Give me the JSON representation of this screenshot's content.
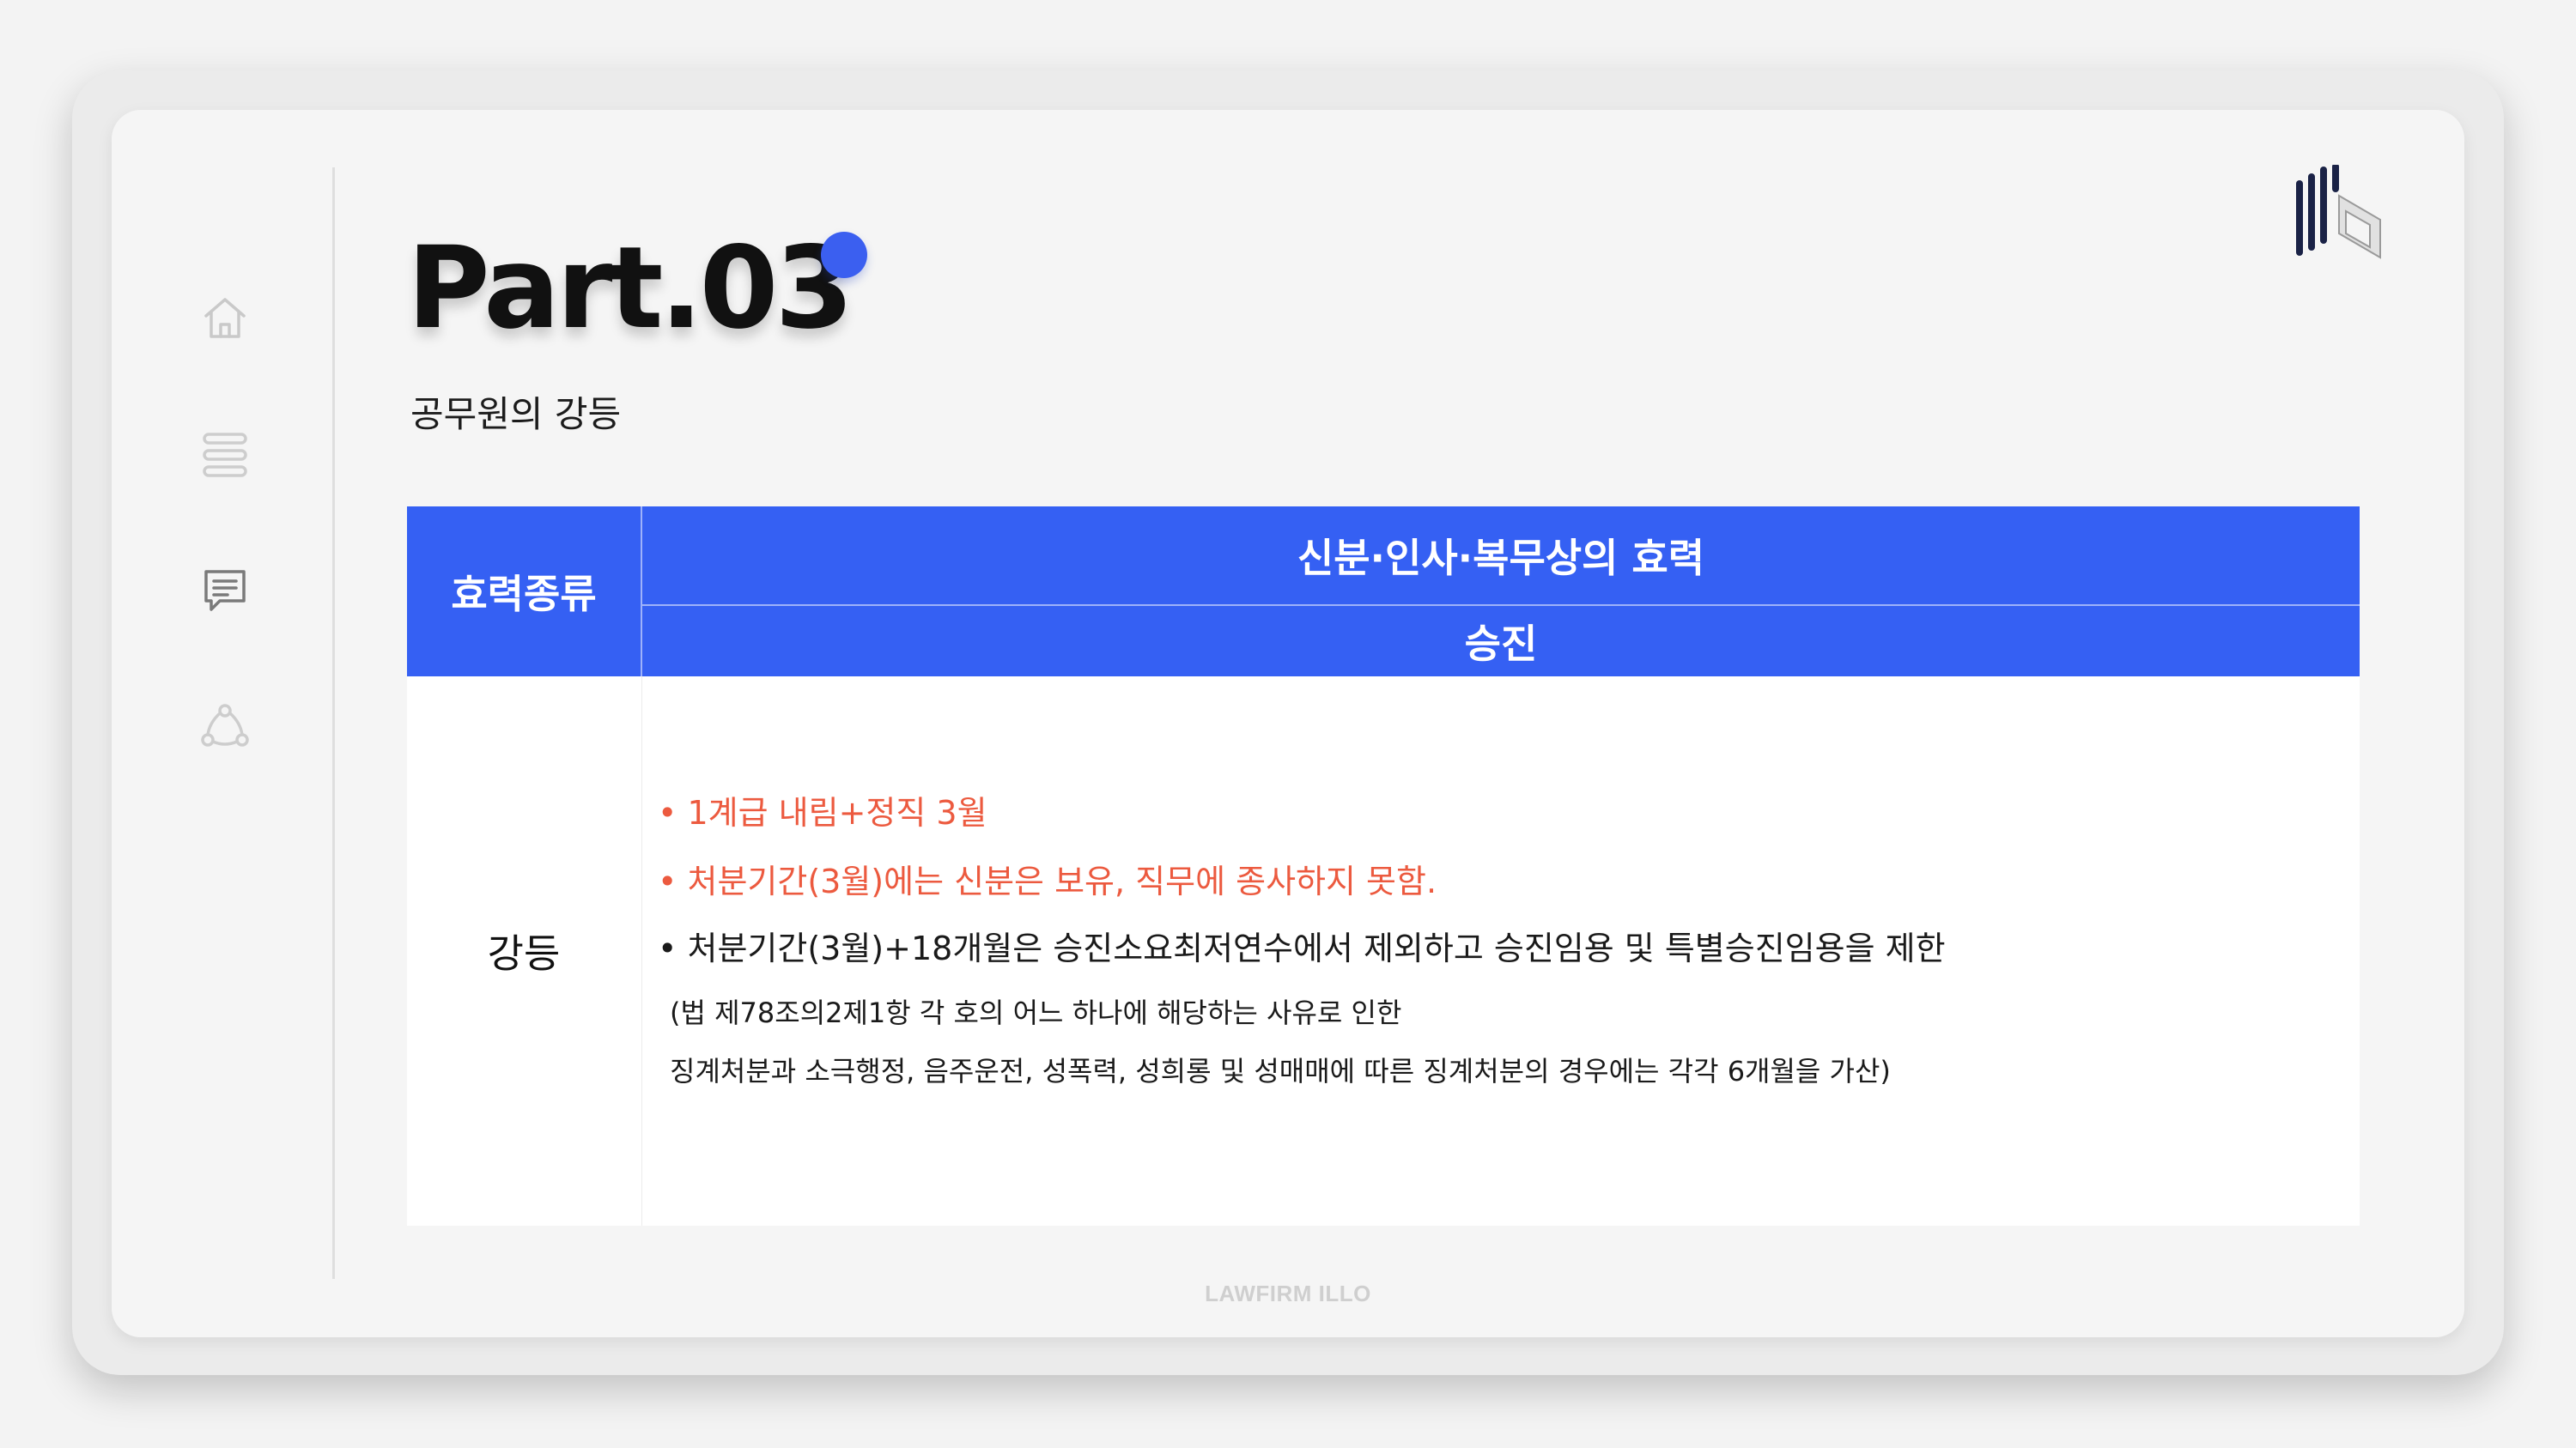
{
  "header": {
    "title": "Part.03",
    "subtitle": "공무원의 강등"
  },
  "sidebar": {
    "icons": [
      "home-icon",
      "list-icon",
      "chat-icon",
      "network-icon"
    ]
  },
  "table": {
    "head_left": "효력종류",
    "head_top": "신분·인사·복무상의 효력",
    "head_bottom": "승진",
    "row_label": "강등",
    "lines": [
      "• 1계급 내림+정직 3월",
      "• 처분기간(3월)에는 신분은 보유, 직무에 종사하지 못함.",
      "• 처분기간(3월)+18개월은 승진소요최저연수에서 제외하고 승진임용 및 특별승진임용을 제한",
      "(법 제78조의2제1항 각 호의 어느 하나에 해당하는 사유로 인한",
      "징계처분과 소극행정, 음주운전, 성폭력, 성희롱 및 성매매에 따른 징계처분의 경우에는 각각 6개월을 가산)"
    ]
  },
  "footer": {
    "brand": "LAWFIRM ILLO"
  },
  "colors": {
    "accent": "#3560f3",
    "highlight": "#ec5a3f",
    "dot": "#3b5ff0"
  }
}
